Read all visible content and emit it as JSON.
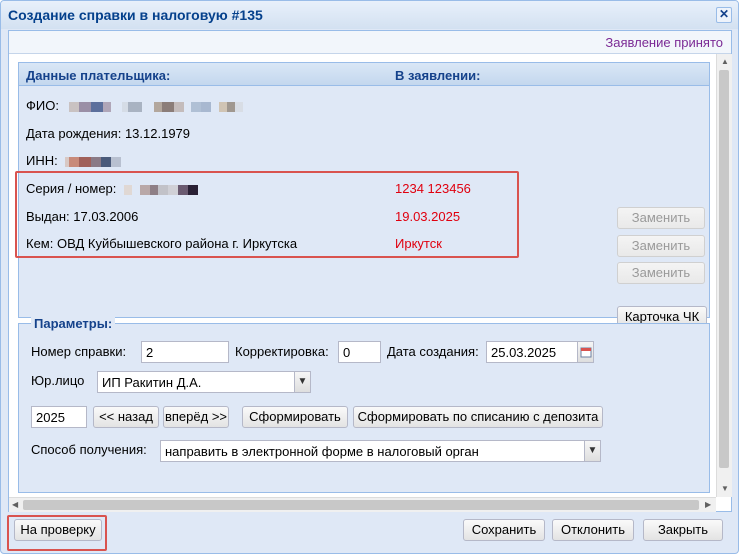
{
  "window": {
    "title": "Создание справки в налоговую #135"
  },
  "status": {
    "text": "Заявление принято"
  },
  "payer": {
    "header_left": "Данные плательщика:",
    "header_right": "В заявлении:",
    "fio_label": "ФИО:",
    "dob_label": "Дата рождения:",
    "dob_value": "13.12.1979",
    "inn_label": "ИНН:",
    "series_label": "Серия / номер:",
    "series_value_app": "1234 123456",
    "issued_label": "Выдан:",
    "issued_value": "17.03.2006",
    "issued_value_app": "19.03.2025",
    "by_label": "Кем:",
    "by_value": "ОВД Куйбышевского района г. Иркутска",
    "by_value_app": "Иркутск",
    "replace_label": "Заменить",
    "card_button": "Карточка ЧК"
  },
  "params": {
    "legend": "Параметры:",
    "number_label": "Номер справки:",
    "number_value": "2",
    "correction_label": "Корректировка:",
    "correction_value": "0",
    "date_label": "Дата создания:",
    "date_value": "25.03.2025",
    "legal_label": "Юр.лицо",
    "legal_value": "ИП Ракитин Д.А.",
    "year_value": "2025",
    "back_button": "<< назад",
    "forward_button": "вперёд >>",
    "generate_button": "Сформировать",
    "generate_deposit_button": "Сформировать по списанию с депозита",
    "method_label": "Способ получения:",
    "method_value": "направить в электронной форме в налоговый орган"
  },
  "footer": {
    "review_button": "На проверку",
    "save_button": "Сохранить",
    "reject_button": "Отклонить",
    "close_button": "Закрыть"
  },
  "icons": {
    "close": "close-icon",
    "calendar": "calendar-icon",
    "dropdown": "chevron-down-icon"
  },
  "colors": {
    "accent": "#15428b",
    "mismatch": "#e0000f",
    "status": "#7b2a95",
    "highlight": "#d9534f"
  }
}
